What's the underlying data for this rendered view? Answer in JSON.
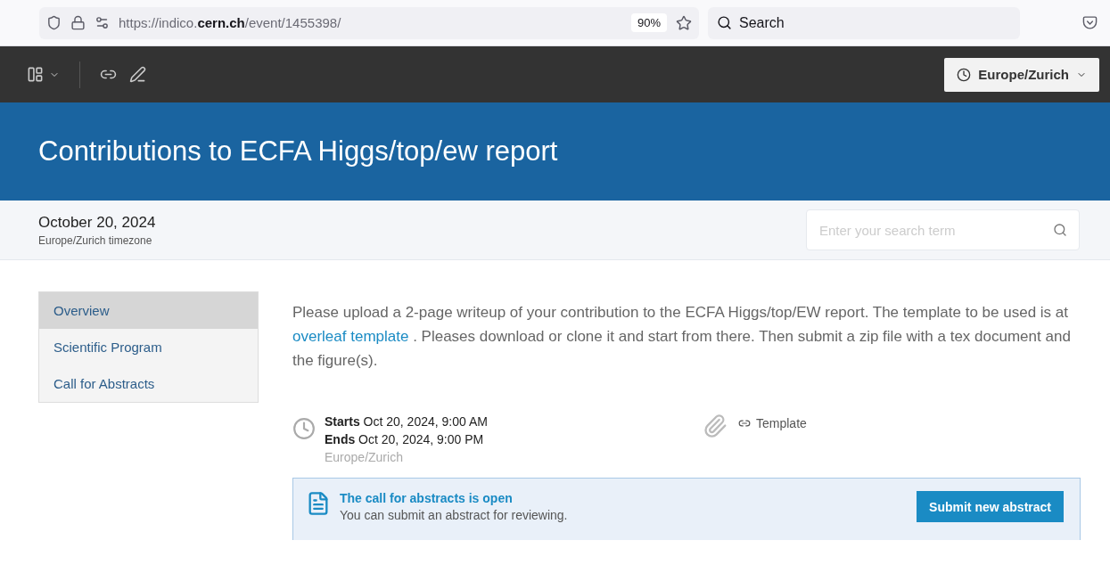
{
  "browser": {
    "url": "https://indico.**cern.ch**/event/1455398/",
    "zoom": "90%",
    "search_placeholder": "Search"
  },
  "toolbar": {
    "timezone": "Europe/Zurich"
  },
  "banner": {
    "title": "Contributions to ECFA Higgs/top/ew report"
  },
  "header": {
    "date": "October 20, 2024",
    "timezone": "Europe/Zurich timezone",
    "search_placeholder": "Enter your search term"
  },
  "menu": [
    {
      "label": "Overview",
      "selected": true
    },
    {
      "label": "Scientific Program",
      "selected": false
    },
    {
      "label": "Call for Abstracts",
      "selected": false
    }
  ],
  "description": {
    "before": "Please upload a 2-page writeup of your contribution to the ECFA Higgs/top/EW report. The template to be used is at",
    "link": "overleaf template",
    "after": ". Pleases download or clone it and start from there. Then submit a zip file with a tex document and the figure(s)."
  },
  "times": {
    "starts": "**Starts** Oct 20, 2024, 9:00 AM",
    "ends": "**Ends** Oct 20, 2024, 9:00 PM",
    "timezone": "Europe/Zurich"
  },
  "attachments": [
    {
      "label": "Template"
    }
  ],
  "abstracts": {
    "title": "The call for abstracts is open",
    "text": "You can submit an abstract for reviewing.",
    "button": "Submit new abstract"
  }
}
